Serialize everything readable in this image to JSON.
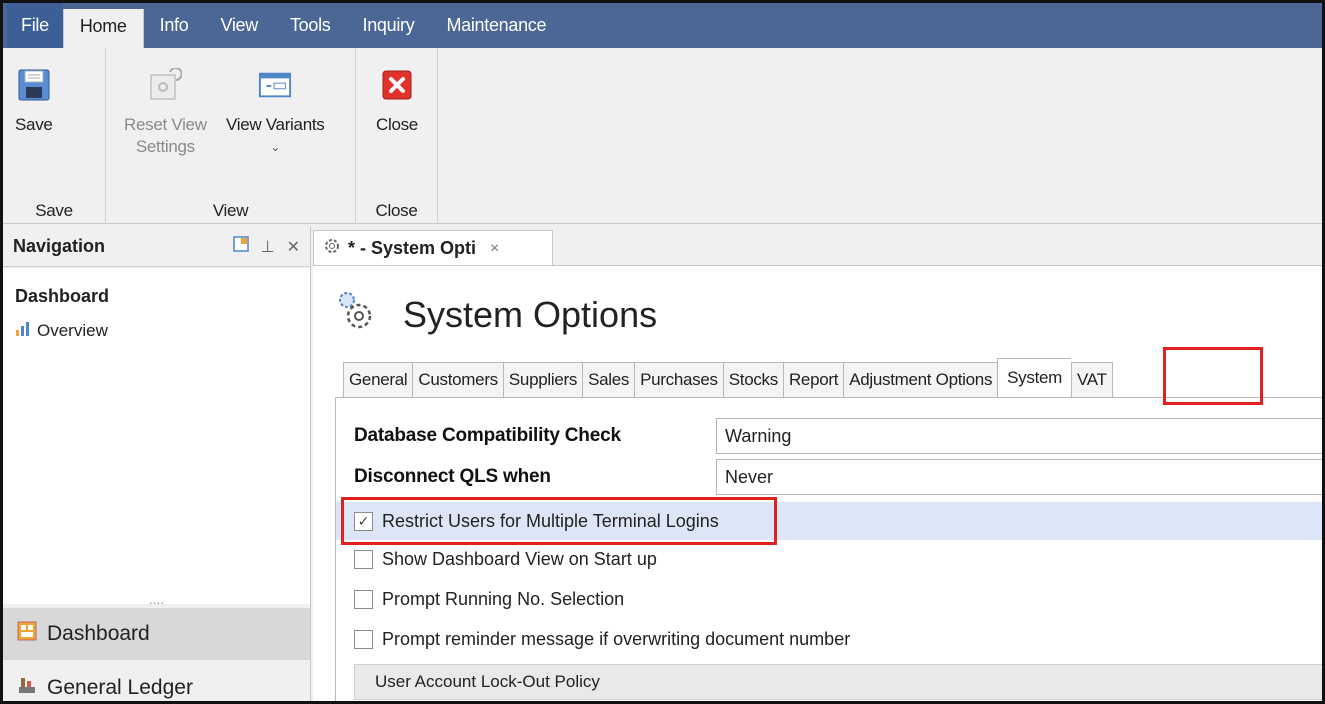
{
  "menu": {
    "items": [
      {
        "label": "File"
      },
      {
        "label": "Home"
      },
      {
        "label": "Info"
      },
      {
        "label": "View"
      },
      {
        "label": "Tools"
      },
      {
        "label": "Inquiry"
      },
      {
        "label": "Maintenance"
      }
    ],
    "active_index": 1
  },
  "ribbon": {
    "save_button": "Save",
    "save_group": "Save",
    "reset_view_line1": "Reset View",
    "reset_view_line2": "Settings",
    "view_variants": "View Variants",
    "view_group": "View",
    "close_button": "Close",
    "close_group": "Close"
  },
  "navigation": {
    "header": "Navigation",
    "section_title": "Dashboard",
    "overview_link": "Overview",
    "dots": "....",
    "bottom_items": [
      {
        "label": "Dashboard",
        "selected": true
      },
      {
        "label": "General Ledger",
        "selected": false
      }
    ]
  },
  "document_tab": {
    "label": "* - System Opti",
    "close": "×"
  },
  "page": {
    "title": "System Options"
  },
  "tabs": [
    {
      "label": "General"
    },
    {
      "label": "Customers"
    },
    {
      "label": "Suppliers"
    },
    {
      "label": "Sales"
    },
    {
      "label": "Purchases"
    },
    {
      "label": "Stocks"
    },
    {
      "label": "Report"
    },
    {
      "label": "Adjustment Options"
    },
    {
      "label": "System",
      "active": true
    },
    {
      "label": "VAT"
    }
  ],
  "system": {
    "db_check_label": "Database Compatibility Check",
    "db_check_value": "Warning",
    "disconnect_label": "Disconnect QLS when",
    "disconnect_value": "Never",
    "checkboxes": [
      {
        "label": "Restrict Users for Multiple Terminal Logins",
        "checked": true
      },
      {
        "label": "Show Dashboard View on Start up",
        "checked": false
      },
      {
        "label": "Prompt Running No. Selection",
        "checked": false
      },
      {
        "label": "Prompt reminder message if overwriting document number",
        "checked": false
      }
    ],
    "lockout_group": "User Account Lock-Out Policy"
  },
  "colors": {
    "menubar": "#4a6796",
    "highlight": "#e32020",
    "selected_row": "#dde6f6"
  }
}
